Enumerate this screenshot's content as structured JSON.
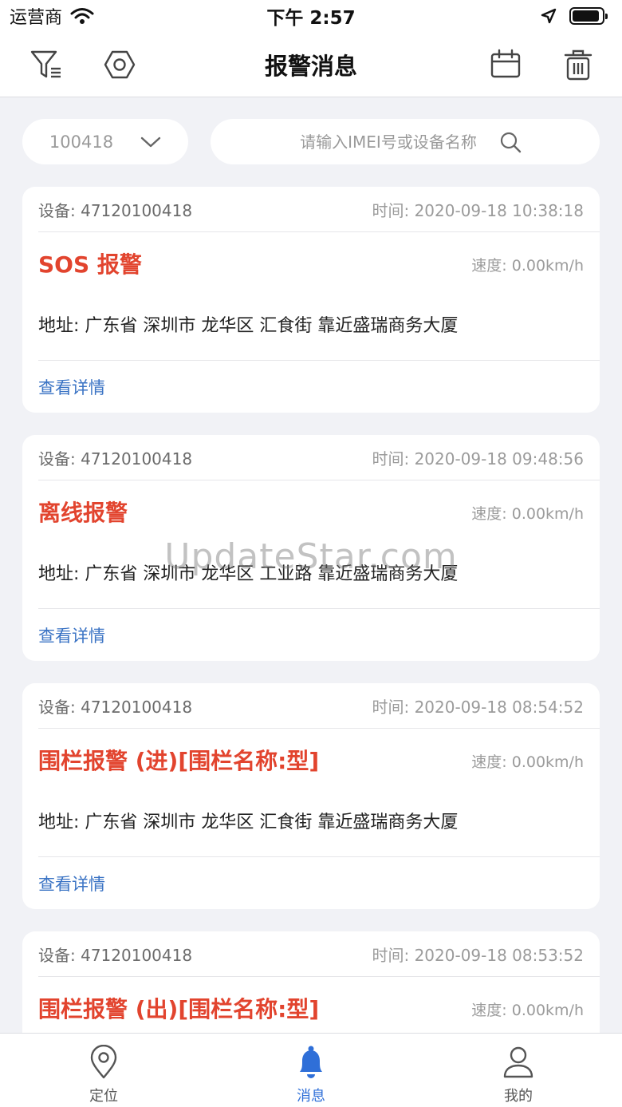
{
  "status_bar": {
    "carrier": "运营商",
    "time": "下午 2:57",
    "battery_level": 0.92
  },
  "nav": {
    "title": "报警消息",
    "icons": [
      "filter-icon",
      "settings-hex-icon",
      "calendar-icon",
      "trash-icon"
    ]
  },
  "filter": {
    "device_value": "100418",
    "search_placeholder": "请输入IMEI号或设备名称"
  },
  "alarms": [
    {
      "device": "设备: 47120100418",
      "time": "时间: 2020-09-18 10:38:18",
      "type": "SOS 报警",
      "speed": "速度: 0.00km/h",
      "address": "地址: 广东省 深圳市 龙华区 汇食街 靠近盛瑞商务大厦",
      "detail_label": "查看详情"
    },
    {
      "device": "设备: 47120100418",
      "time": "时间: 2020-09-18 09:48:56",
      "type": "离线报警",
      "speed": "速度: 0.00km/h",
      "address": "地址: 广东省 深圳市 龙华区 工业路 靠近盛瑞商务大厦",
      "detail_label": "查看详情"
    },
    {
      "device": "设备: 47120100418",
      "time": "时间: 2020-09-18 08:54:52",
      "type": "围栏报警 (进)[围栏名称:型]",
      "speed": "速度: 0.00km/h",
      "address": "地址: 广东省 深圳市 龙华区 汇食街 靠近盛瑞商务大厦",
      "detail_label": "查看详情"
    },
    {
      "device": "设备: 47120100418",
      "time": "时间: 2020-09-18 08:53:52",
      "type": "围栏报警 (出)[围栏名称:型]",
      "speed": "速度: 0.00km/h",
      "address": "",
      "detail_label": ""
    }
  ],
  "watermark": "UpdateStar.com",
  "tabs": [
    {
      "label": "定位",
      "icon": "location-pin-icon",
      "active": false
    },
    {
      "label": "消息",
      "icon": "bell-icon",
      "active": true
    },
    {
      "label": "我的",
      "icon": "user-icon",
      "active": false
    }
  ],
  "colors": {
    "alarm": "#e2442e",
    "link": "#3a73c4",
    "tab_active": "#2f6fd8",
    "background": "#f1f2f6"
  }
}
